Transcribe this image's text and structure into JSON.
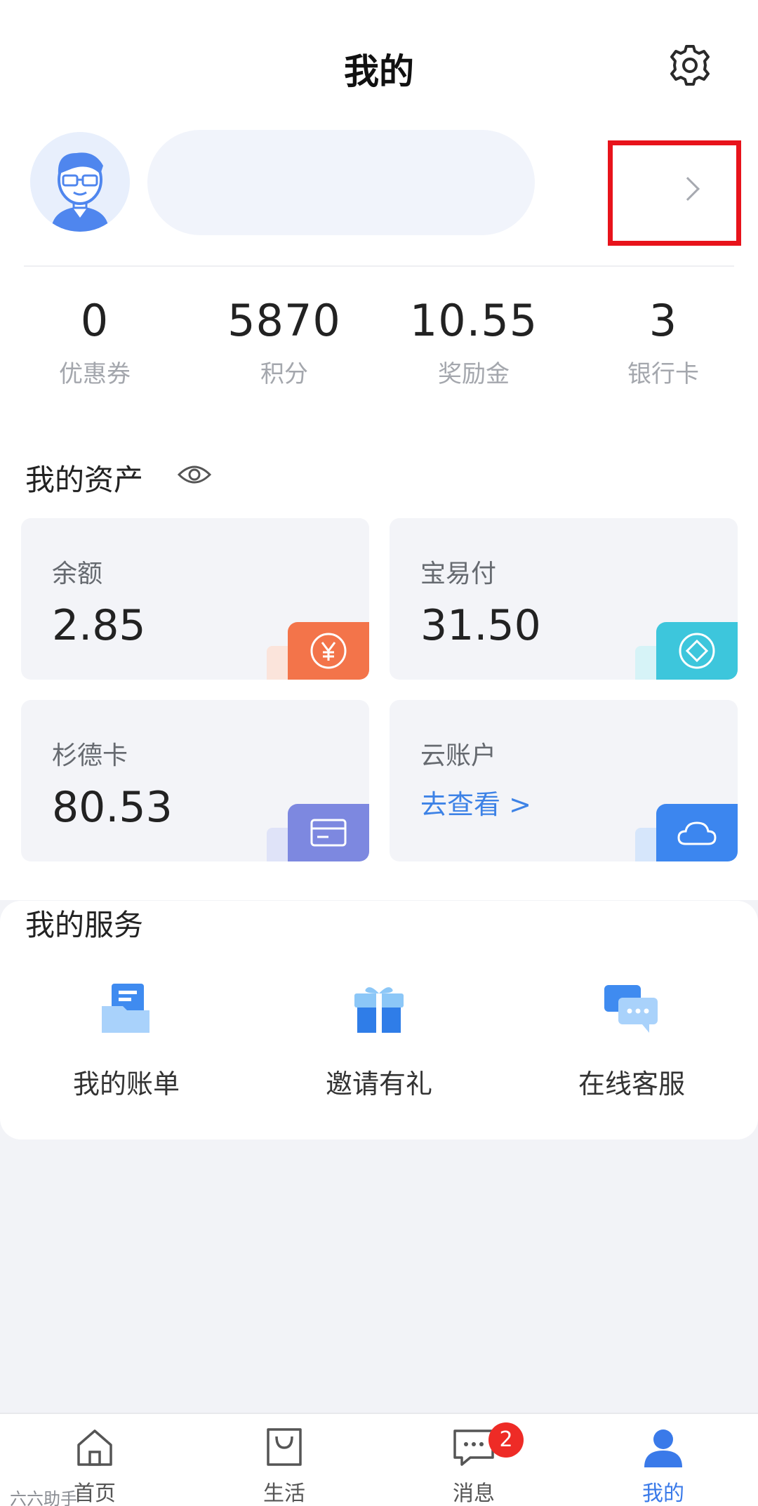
{
  "header": {
    "title": "我的"
  },
  "stats": [
    {
      "value": "0",
      "label": "优惠券"
    },
    {
      "value": "5870",
      "label": "积分"
    },
    {
      "value": "10.55",
      "label": "奖励金"
    },
    {
      "value": "3",
      "label": "银行卡"
    }
  ],
  "assets": {
    "title": "我的资产",
    "cards": [
      {
        "label": "余额",
        "value": "2.85",
        "icon": "yen-icon",
        "color": "#f3744a"
      },
      {
        "label": "宝易付",
        "value": "31.50",
        "icon": "diamond-icon",
        "color": "#3dc6dc"
      },
      {
        "label": "杉德卡",
        "value": "80.53",
        "icon": "card-icon",
        "color": "#7d88e0"
      },
      {
        "label": "云账户",
        "link": "去查看 >",
        "icon": "cloud-icon",
        "color": "#3c86ef"
      }
    ]
  },
  "services": {
    "title": "我的服务",
    "items": [
      {
        "label": "我的账单",
        "icon": "bill-icon"
      },
      {
        "label": "邀请有礼",
        "icon": "gift-icon"
      },
      {
        "label": "在线客服",
        "icon": "chat-bubble-icon"
      }
    ]
  },
  "tabbar": {
    "items": [
      {
        "label": "首页",
        "icon": "home-icon"
      },
      {
        "label": "生活",
        "icon": "bag-icon"
      },
      {
        "label": "消息",
        "icon": "message-icon",
        "badge": "2"
      },
      {
        "label": "我的",
        "icon": "person-icon",
        "active": true
      }
    ]
  },
  "watermark": "六六助手"
}
